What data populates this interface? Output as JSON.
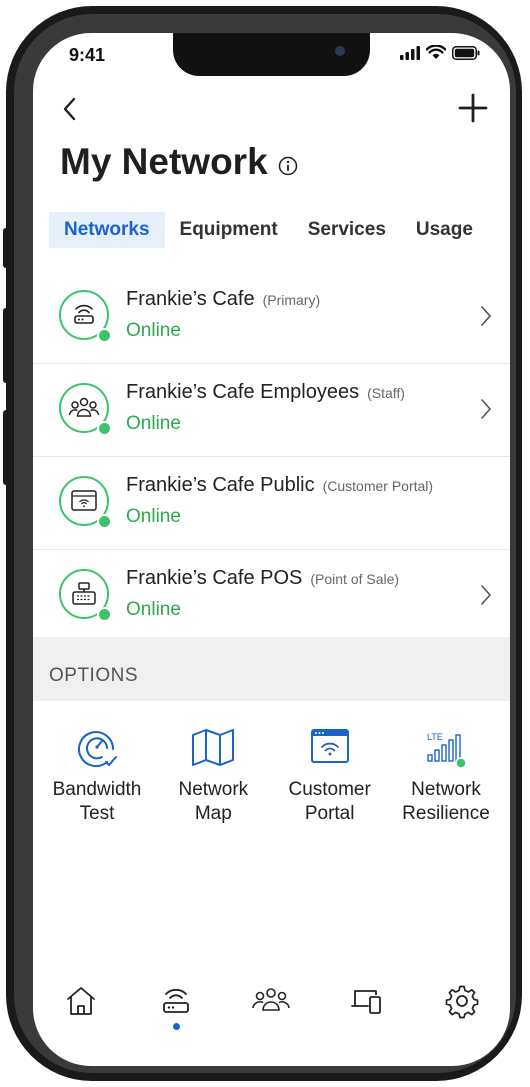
{
  "status_bar": {
    "time": "9:41"
  },
  "header": {
    "title": "My Network"
  },
  "tabs": [
    {
      "label": "Networks",
      "active": true
    },
    {
      "label": "Equipment",
      "active": false
    },
    {
      "label": "Services",
      "active": false
    },
    {
      "label": "Usage",
      "active": false
    }
  ],
  "networks": [
    {
      "name": "Frankie’s Cafe",
      "tag": "(Primary)",
      "status": "Online",
      "icon": "router-icon",
      "has_chevron": true
    },
    {
      "name": "Frankie’s Cafe Employees",
      "tag": "(Staff)",
      "status": "Online",
      "icon": "people-icon",
      "has_chevron": true
    },
    {
      "name": "Frankie’s Cafe Public",
      "tag": "(Customer Portal)",
      "status": "Online",
      "icon": "portal-icon",
      "has_chevron": false
    },
    {
      "name": "Frankie’s Cafe POS",
      "tag": "(Point of Sale)",
      "status": "Online",
      "icon": "register-icon",
      "has_chevron": true
    }
  ],
  "options": {
    "header": "OPTIONS",
    "items": [
      {
        "line1": "Bandwidth",
        "line2": "Test",
        "icon": "speedometer-icon"
      },
      {
        "line1": "Network",
        "line2": "Map",
        "icon": "map-icon"
      },
      {
        "line1": "Customer",
        "line2": "Portal",
        "icon": "portal-icon"
      },
      {
        "line1": "Network",
        "line2": "Resilience",
        "icon": "lte-signal-icon",
        "icon_text": "LTE"
      }
    ]
  },
  "bottom_nav": [
    {
      "icon": "home-icon",
      "active": false
    },
    {
      "icon": "router-icon",
      "active": true
    },
    {
      "icon": "people-icon",
      "active": false
    },
    {
      "icon": "devices-icon",
      "active": false
    },
    {
      "icon": "settings-icon",
      "active": false
    }
  ],
  "colors": {
    "accent": "#1a63c9",
    "online": "#2ea84f",
    "tab_active_bg": "#e6f0fb",
    "options_bg": "#f0f0f0"
  }
}
